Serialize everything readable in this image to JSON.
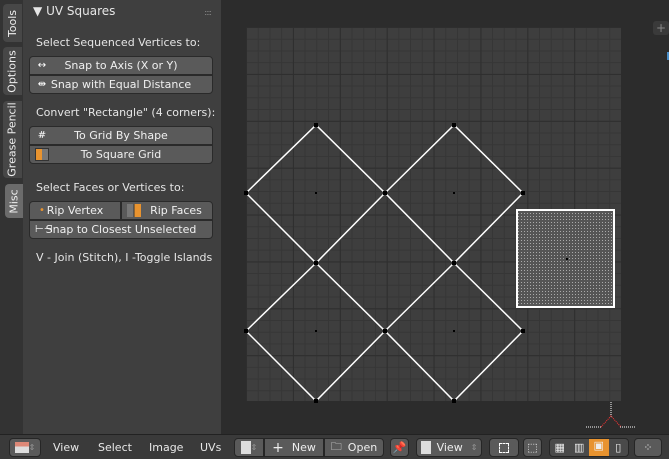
{
  "tabs": [
    "Tools",
    "Options",
    "Grease Pencil",
    "Misc"
  ],
  "panel": {
    "title": "UV Squares",
    "section1": "Select Sequenced Vertices to:",
    "snap_axis": "Snap to Axis (X or Y)",
    "snap_equal": "Snap with Equal Distance",
    "section2": "Convert \"Rectangle\" (4 corners):",
    "grid_shape": "To Grid By Shape",
    "square_grid": "To Square Grid",
    "section3": "Select Faces or Vertices to:",
    "rip_vertex": "Rip Vertex",
    "rip_faces": "Rip Faces",
    "snap_closest": "Snap to Closest Unselected",
    "hint": "V - Join (Stitch), I -Toggle Islands"
  },
  "header": {
    "menus": [
      "View",
      "Select",
      "Image",
      "UVs"
    ],
    "new": "New",
    "open": "Open",
    "view": "View"
  },
  "colors": {
    "accent": "#e8932f",
    "selected": "#f0a040"
  }
}
